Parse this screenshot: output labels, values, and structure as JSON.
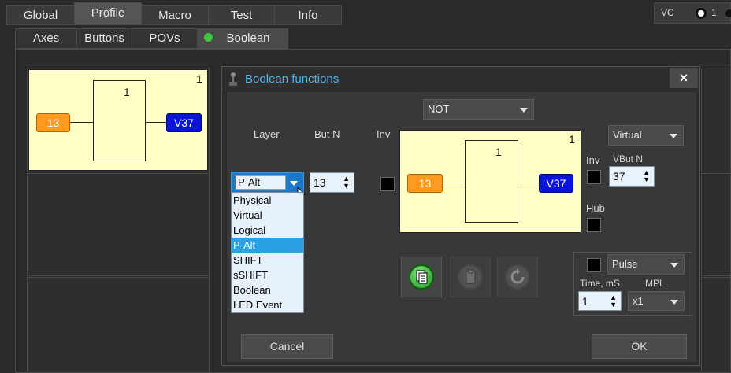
{
  "tabs": [
    {
      "label": "Global"
    },
    {
      "label": "Profile"
    },
    {
      "label": "Macro"
    },
    {
      "label": "Test"
    },
    {
      "label": "Info"
    }
  ],
  "subtabs": [
    {
      "label": "Axes"
    },
    {
      "label": "Buttons"
    },
    {
      "label": "POVs"
    },
    {
      "label": "Boolean"
    }
  ],
  "vc": {
    "label": "VC",
    "radio1_label": "1"
  },
  "preview": {
    "corner": "1",
    "gate_label": "1",
    "input": "13",
    "output": "V37"
  },
  "dialog": {
    "title": "Boolean functions",
    "close": "×",
    "function_select": "NOT",
    "layer_label": "Layer",
    "butn_label": "But N",
    "inv_label": "Inv",
    "layer_value": "P-Alt",
    "butn_value": "13",
    "layer_options": [
      "Physical",
      "Virtual",
      "Logical",
      "P-Alt",
      "SHIFT",
      "sSHIFT",
      "Boolean",
      "LED Event"
    ],
    "layer_selected_index": 3,
    "diagram": {
      "corner": "1",
      "gate_label": "1",
      "input": "13",
      "output": "V37"
    },
    "output_type": "Virtual",
    "inv2_label": "Inv",
    "vbut_label": "VBut N",
    "vbut_value": "37",
    "hub_label": "Hub",
    "pulse_select": "Pulse",
    "time_label": "Time, mS",
    "mpl_label": "MPL",
    "time_value": "1",
    "mpl_value": "x1",
    "cancel": "Cancel",
    "ok": "OK"
  },
  "colors": {
    "input_pill": "#ff9a1e",
    "output_pill": "#0a14d8",
    "diagram_bg": "#ffffc6",
    "selected_item": "#2ba0e3",
    "title_text": "#4fb3f0",
    "led_green": "#3fc83f"
  }
}
